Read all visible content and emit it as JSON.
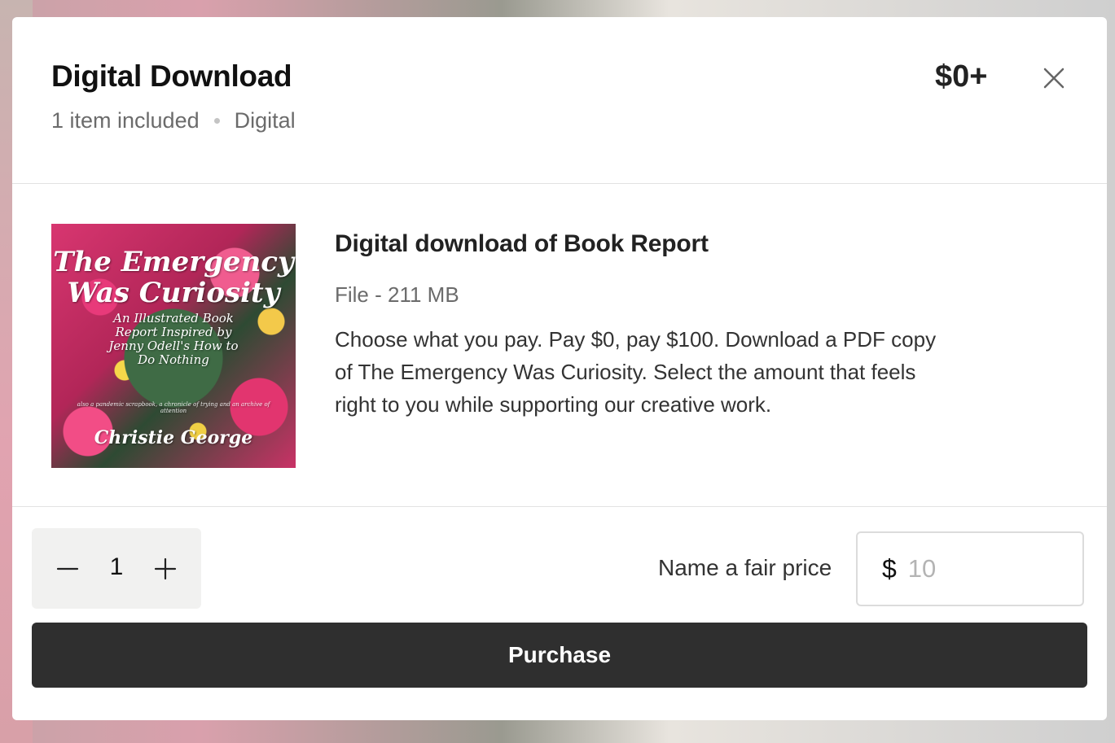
{
  "header": {
    "title": "Digital Download",
    "items_included": "1 item included",
    "type": "Digital",
    "price": "$0+",
    "close_icon": "close-icon"
  },
  "item": {
    "cover_image": {
      "title": "The Emergency Was Curiosity",
      "subtitle": "An Illustrated Book Report Inspired by Jenny Odell's How to Do Nothing",
      "tagline": "also a pandemic scrapbook, a chronicle of trying and an archive of attention",
      "author": "Christie George"
    },
    "title": "Digital download of Book Report",
    "file_info": "File - 211 MB",
    "description": "Choose what you pay. Pay $0, pay $100. Download a PDF copy of The Emergency Was Curiosity. Select the amount that feels right to you while supporting our creative work."
  },
  "footer": {
    "quantity": "1",
    "minus_icon": "minus-icon",
    "plus_icon": "plus-icon",
    "fair_price_label": "Name a fair price",
    "currency_symbol": "$",
    "price_placeholder": "10",
    "purchase_label": "Purchase"
  },
  "colors": {
    "button_bg": "#2f2f2f",
    "stepper_bg": "#f1f1f0",
    "muted_text": "#6b6b6b"
  }
}
